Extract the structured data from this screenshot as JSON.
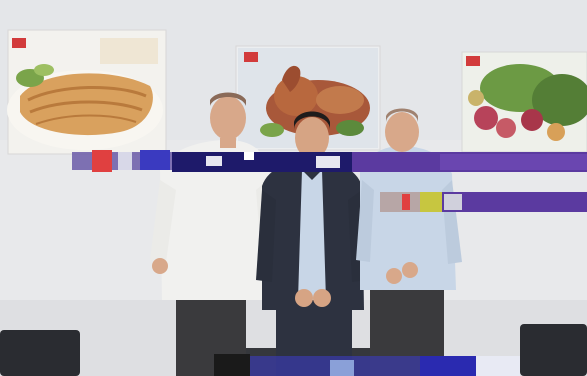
{
  "scene": {
    "description_colors": {
      "wall": "#e9eaec",
      "wall_shadow": "#d9dadd",
      "poster_frame": "#f4f4f2",
      "food_crust": "#d9a15e",
      "food_plate": "#f7f4ee",
      "roast_chicken": "#a8583a",
      "vegetables_green": "#6c9a44",
      "vegetables_red": "#b7435a",
      "shirt_white": "#f1f1ef",
      "shirt_blue": "#c8d6e7",
      "suit_dark": "#2d3240",
      "trousers_dark": "#3a3a3d",
      "skin": "#d8a88a",
      "hair_dark": "#1e1c1c",
      "glitch_purple": "#5b3aa0",
      "glitch_blue": "#3a3ac0",
      "glitch_red": "#e04040",
      "chair_dark": "#2a2c31"
    }
  }
}
